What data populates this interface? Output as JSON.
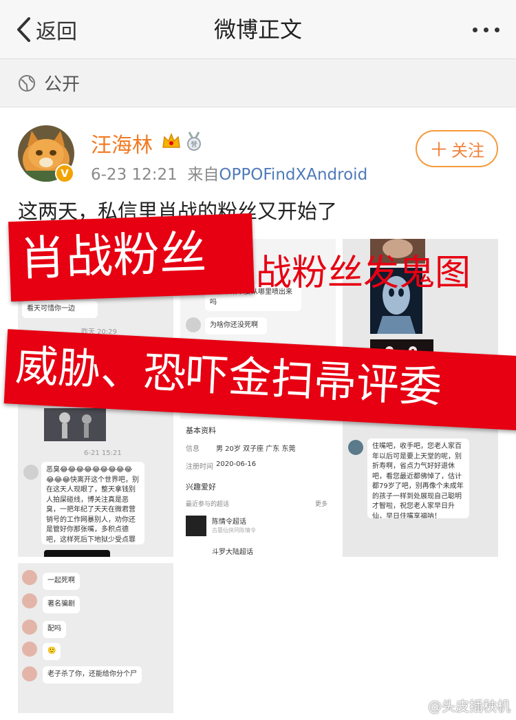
{
  "nav": {
    "back_label": "返回",
    "title": "微博正文"
  },
  "visibility": {
    "label": "公开"
  },
  "post": {
    "author": "汪海林",
    "verified_badge": "V",
    "time": "6-23 12:21",
    "source_prefix": "来自",
    "source": "OPPOFindXAndroid",
    "follow_label": "关注",
    "text": "这两天，私信里肖战的粉丝又开始了"
  },
  "overlay": {
    "banner1": "肖战粉丝",
    "red_text": "战粉丝发鬼图",
    "banner2": "威胁、恐吓金扫帚评委"
  },
  "screenshot1": {
    "reply_fragment": "看天可惜你一边",
    "time1": "昨天 20:29",
    "time2": "6-21 15:21",
    "message": "恶臭😂😂😂😂😂😂😂😂😂😂😂😂快离开这个世界吧，别在这天人现眼了，整天拿钱别人拍屎碰线，博关注真是恶臭，一把年纪了天天在微君营销号的工作网暴别人，劝你还是管好你那张嘴，多积点德吧，这样死后下地狱少受点罪"
  },
  "screenshot2": {
    "msg1": "装不下所以要从哪里喷出来吗",
    "msg2": "为啥你还没死啊",
    "section_basic": "基本资料",
    "info_label": "信息",
    "info_value": "男 20岁 双子座 广东 东莞",
    "reg_label": "注册时间",
    "reg_value": "2020-06-16",
    "section_interest": "兴趣爱好",
    "topics_label": "最近参与的超话",
    "more_label": "更多",
    "topic1": "陈情令超话",
    "topic1_sub": "古墓仙侠同陈情令",
    "topic2": "斗罗大陆超话"
  },
  "screenshot3": {
    "message": "住嘴吧，收手吧，您老人家百年以后可是要上天堂的呢，别折寿啊，省点力气好好退休吧，看您最近都佛悼了，估计都79岁了吧，别再像个未成年的孩子一样到处展现自己聪明才智啦，祝您老人家早日升仙，早日住嘴享福呐！"
  },
  "screenshot4": {
    "messages": [
      "一起死啊",
      "著名骗剧",
      "配吗",
      "🙂",
      "老子杀了你，还能给你分个尸"
    ]
  },
  "watermark": "@头皮插秧机",
  "colors": {
    "accent_orange": "#f27a22",
    "banner_red": "#e60012",
    "source_blue": "#4f7ab8"
  }
}
